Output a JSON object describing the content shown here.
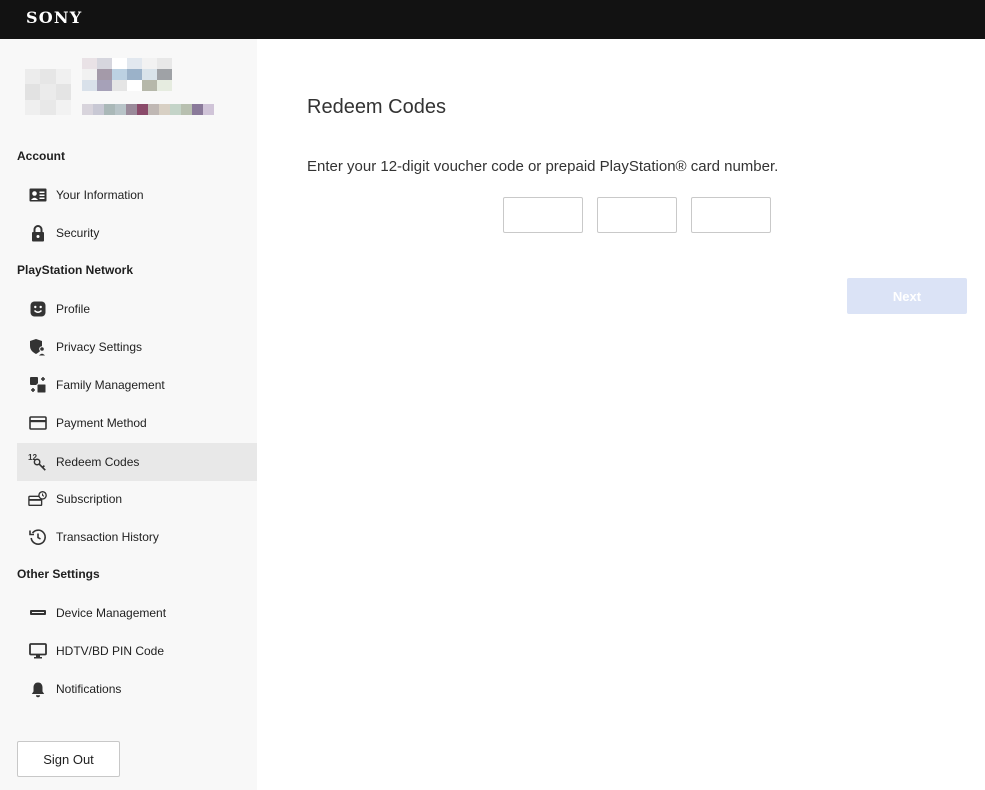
{
  "header": {
    "brand": "SONY"
  },
  "user": {
    "avatar_colors": [
      "#ececec",
      "#e6e6e6",
      "#f0f0f0",
      "#e2e2e2",
      "#ebebeb",
      "#e4e4e4",
      "#efefef",
      "#e8e8e8",
      "#f2f2f2"
    ],
    "name_colors": [
      "#e9e2e6",
      "#d6d6de",
      "#ffffff",
      "#e2e8ef",
      "#f2f2f2",
      "#e8e8e8",
      "#f1f1f1",
      "#a49aa9",
      "#bcd1e2",
      "#9bb2c9",
      "#d9e3ea",
      "#9fa2a6",
      "#d9e1ea",
      "#a6a1b8",
      "#e5e5e5",
      "#ffffff",
      "#b6b8aa",
      "#e6ece0"
    ],
    "sub_colors": [
      "#d8d4dc",
      "#c8c8d4",
      "#aab8b8",
      "#b8c4c8",
      "#9a8a9a",
      "#8a4a6a",
      "#c0b8b4",
      "#d8d0c4",
      "#c4d4c8",
      "#b8c0b0",
      "#8a7a9a",
      "#d0c4d8"
    ]
  },
  "sidebar": {
    "sections": [
      {
        "title": "Account",
        "items": [
          {
            "label": "Your Information",
            "icon": "id-card-icon"
          },
          {
            "label": "Security",
            "icon": "lock-icon"
          }
        ]
      },
      {
        "title": "PlayStation Network",
        "items": [
          {
            "label": "Profile",
            "icon": "smiley-icon"
          },
          {
            "label": "Privacy Settings",
            "icon": "shield-person-icon"
          },
          {
            "label": "Family Management",
            "icon": "family-icon"
          },
          {
            "label": "Payment Method",
            "icon": "credit-card-icon"
          },
          {
            "label": "Redeem Codes",
            "icon": "code-key-icon"
          },
          {
            "label": "Subscription",
            "icon": "subscription-icon"
          },
          {
            "label": "Transaction History",
            "icon": "history-icon"
          }
        ]
      },
      {
        "title": "Other Settings",
        "items": [
          {
            "label": "Device Management",
            "icon": "device-icon"
          },
          {
            "label": "HDTV/BD PIN Code",
            "icon": "monitor-icon"
          },
          {
            "label": "Notifications",
            "icon": "bell-icon"
          }
        ]
      }
    ],
    "active_item": "Redeem Codes",
    "sign_out_label": "Sign Out"
  },
  "main": {
    "title": "Redeem Codes",
    "instruction": "Enter your 12-digit voucher code or prepaid PlayStation® card number.",
    "code_fields": [
      {
        "value": "",
        "placeholder": ""
      },
      {
        "value": "",
        "placeholder": ""
      },
      {
        "value": "",
        "placeholder": ""
      }
    ],
    "next_label": "Next",
    "next_enabled": false
  },
  "colors": {
    "header_bg": "#121212",
    "sidebar_bg": "#f8f8f8",
    "active_item_bg": "#e8e8e8",
    "next_disabled_bg": "#dbe3f6"
  }
}
